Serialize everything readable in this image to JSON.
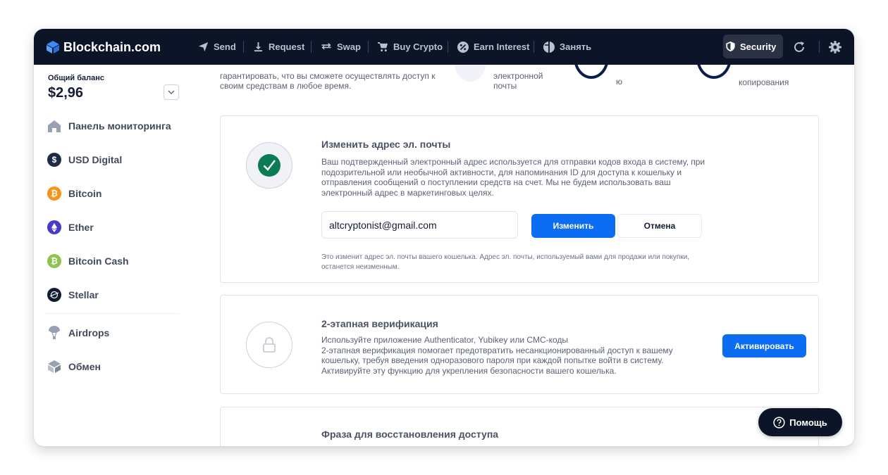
{
  "brand": {
    "name": "Blockchain.com"
  },
  "nav": {
    "items": [
      {
        "label": "Send",
        "icon": "send-icon"
      },
      {
        "label": "Request",
        "icon": "download-icon"
      },
      {
        "label": "Swap",
        "icon": "swap-icon"
      },
      {
        "label": "Buy Crypto",
        "icon": "cart-icon"
      },
      {
        "label": "Earn Interest",
        "icon": "percent-icon"
      },
      {
        "label": "Занять",
        "icon": "borrow-icon"
      }
    ],
    "security_label": "Security"
  },
  "sidebar": {
    "balance_label": "Общий баланс",
    "balance_value": "$2,96",
    "items": [
      {
        "label": "Панель мониторинга",
        "icon": "home-icon"
      },
      {
        "label": "USD Digital",
        "icon": "usd-digital-icon",
        "color": "#1f2b45"
      },
      {
        "label": "Bitcoin",
        "icon": "bitcoin-icon",
        "color": "#f7931a"
      },
      {
        "label": "Ether",
        "icon": "ether-icon",
        "color": "#473bcb"
      },
      {
        "label": "Bitcoin Cash",
        "icon": "bitcoin-cash-icon",
        "color": "#8dc351"
      },
      {
        "label": "Stellar",
        "icon": "stellar-icon",
        "color": "#121d33"
      },
      {
        "label": "Airdrops",
        "icon": "parachute-icon"
      },
      {
        "label": "Обмен",
        "icon": "exchange-icon"
      }
    ]
  },
  "partial_top": {
    "text1_line1": "гарантировать, что вы сможете осуществлять доступ к",
    "text1_line2": "своим средствам в любое время.",
    "text2_line1": "электронной",
    "text2_line2": "почты",
    "text3": "ю",
    "text4": "копирования"
  },
  "email_card": {
    "title": "Изменить адрес эл. почты",
    "description": "Ваш подтвержденный электронный адрес используется для отправки кодов входа в систему, при подозрительной или необычной активности, для напоминания ID для доступа к кошельку и отправления сообщений о поступлении средств на счет. Мы не будем использовать ваш электронный адрес в маркетинговых целях.",
    "email_value": "altcryptonist@gmail.com",
    "change_label": "Изменить",
    "cancel_label": "Отмена",
    "note": "Это изменит адрес эл. почты вашего кошелька. Адрес эл. почты, используемый вами для продажи или покупки, останется неизменным."
  },
  "twofa_card": {
    "title": "2-этапная верификация",
    "description_line1": "Используйте приложение Authenticator, Yubikey или СМС-коды",
    "description_line2": "2-этапная верификация помогает предотвратить несанкционированный доступ к вашему кошельку, требуя введения одноразового пароля при каждой попытке войти в систему. Активируйте эту функцию для укрепления безопасности вашего кошелька.",
    "activate_label": "Активировать"
  },
  "recovery_card": {
    "title": "Фраза для восстановления доступа"
  },
  "help": {
    "label": "Помощь"
  },
  "colors": {
    "accent": "#0c6cf2",
    "topbar": "#0c1427",
    "success": "#0a7b52"
  }
}
